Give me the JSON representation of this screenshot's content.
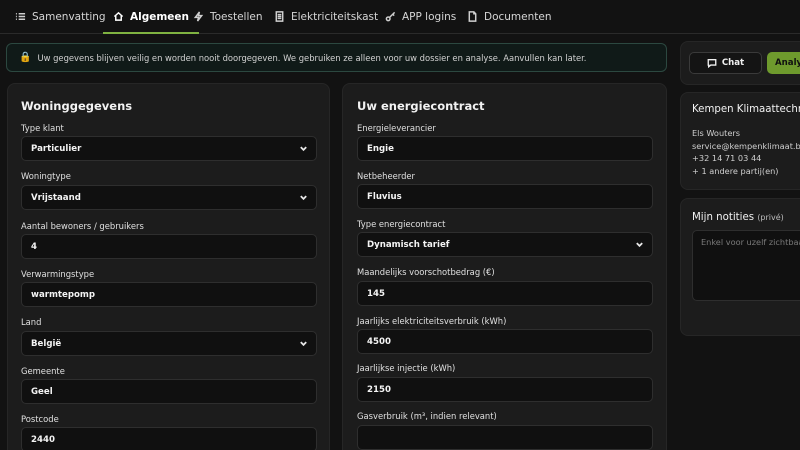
{
  "tabs": [
    {
      "label": "Samenvatting",
      "icon": "list-icon"
    },
    {
      "label": "Algemeen",
      "icon": "home-icon",
      "active": true
    },
    {
      "label": "Toestellen",
      "icon": "bolt-icon"
    },
    {
      "label": "Elektriciteitskast",
      "icon": "document-icon"
    },
    {
      "label": "APP logins",
      "icon": "key-icon"
    },
    {
      "label": "Documenten",
      "icon": "file-icon"
    }
  ],
  "banner": {
    "icon": "lock-icon",
    "text": "Uw gegevens blijven veilig en worden nooit doorgegeven. We gebruiken ze alleen voor uw dossier en analyse. Aanvullen kan later."
  },
  "woning": {
    "title": "Woninggegevens",
    "fields": {
      "type_klant": {
        "label": "Type klant",
        "value": "Particulier"
      },
      "woningtype": {
        "label": "Woningtype",
        "value": "Vrijstaand"
      },
      "bewoners": {
        "label": "Aantal bewoners / gebruikers",
        "value": "4"
      },
      "verwarming": {
        "label": "Verwarmingstype",
        "value": "warmtepomp"
      },
      "land": {
        "label": "Land",
        "value": "België"
      },
      "gemeente": {
        "label": "Gemeente",
        "value": "Geel"
      },
      "postcode": {
        "label": "Postcode",
        "value": "2440"
      }
    }
  },
  "contract": {
    "title": "Uw energiecontract",
    "fields": {
      "leverancier": {
        "label": "Energieleverancier",
        "value": "Engie"
      },
      "netbeheerder": {
        "label": "Netbeheerder",
        "value": "Fluvius"
      },
      "type": {
        "label": "Type energiecontract",
        "value": "Dynamisch tarief"
      },
      "voorschot": {
        "label": "Maandelijks voorschotbedrag (€)",
        "value": "145"
      },
      "verbruik": {
        "label": "Jaarlijks elektriciteitsverbruik (kWh)",
        "value": "4500"
      },
      "injectie": {
        "label": "Jaarlijkse injectie (kWh)",
        "value": "2150"
      },
      "gas": {
        "label": "Gasverbruik (m³, indien relevant)",
        "value": ""
      }
    }
  },
  "actions": {
    "chat_label": "Chat",
    "analyse_label": "Analys"
  },
  "company": {
    "name": "Kempen Klimaattechnie",
    "contact_name": "Els Wouters",
    "email": "service@kempenklimaat.be",
    "phone": "+32 14 71 03 44",
    "more": "+ 1 andere partij(en)"
  },
  "notes": {
    "title": "Mijn notities",
    "subtitle": "(privé)",
    "placeholder": "Enkel voor uzelf zichtbaa"
  },
  "colors": {
    "accent": "#7fb241",
    "button_green": "#6e9a2d",
    "background": "#121212",
    "card": "#1c1c1c"
  }
}
